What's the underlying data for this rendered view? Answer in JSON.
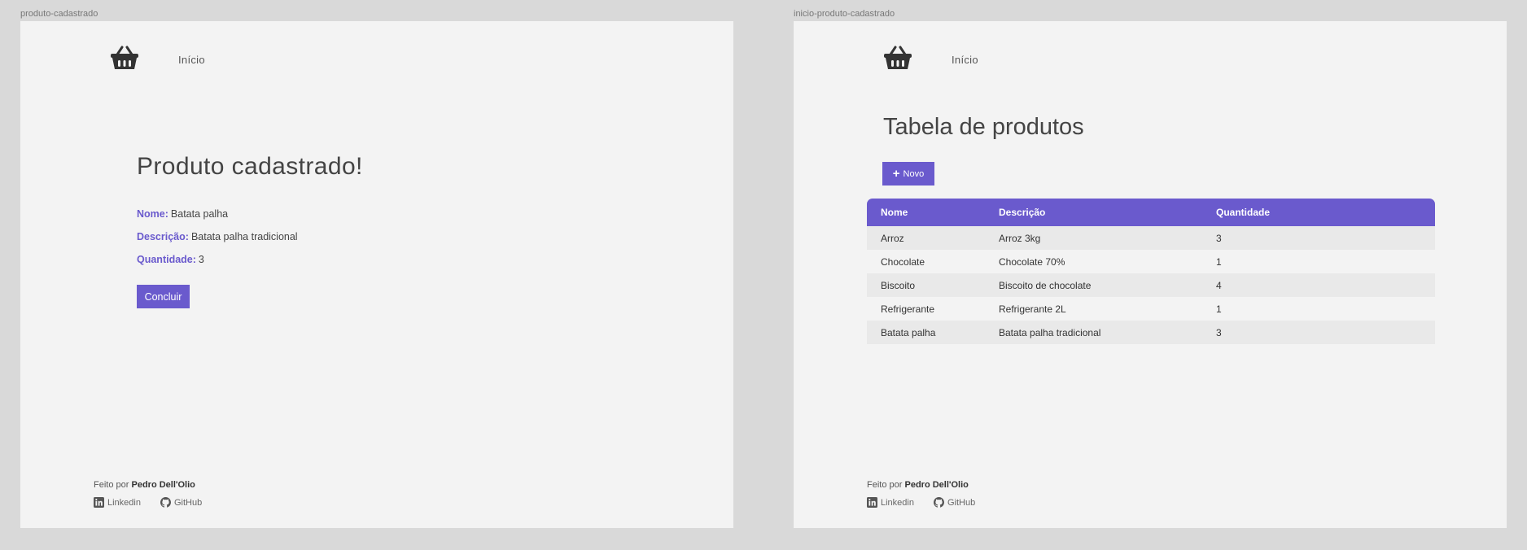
{
  "frames": [
    {
      "label": "produto-cadastrado",
      "nav": {
        "link": "Início"
      },
      "title": "Produto cadastrado!",
      "fields": [
        {
          "label": "Nome:",
          "value": "Batata palha"
        },
        {
          "label": "Descrição:",
          "value": "Batata palha tradicional"
        },
        {
          "label": "Quantidade:",
          "value": "3"
        }
      ],
      "button": "Concluir",
      "footer": {
        "prefix": "Feito por",
        "author": "Pedro Dell'Olio",
        "links": [
          "Linkedin",
          "GitHub"
        ]
      }
    },
    {
      "label": "inicio-produto-cadastrado",
      "nav": {
        "link": "Início"
      },
      "title": "Tabela de produtos",
      "button": "Novo",
      "table": {
        "headers": [
          "Nome",
          "Descrição",
          "Quantidade"
        ],
        "rows": [
          [
            "Arroz",
            "Arroz 3kg",
            "3"
          ],
          [
            "Chocolate",
            "Chocolate 70%",
            "1"
          ],
          [
            "Biscoito",
            "Biscoito de chocolate",
            "4"
          ],
          [
            "Refrigerante",
            "Refrigerante 2L",
            "1"
          ],
          [
            "Batata palha",
            "Batata palha tradicional",
            "3"
          ]
        ]
      },
      "footer": {
        "prefix": "Feito por",
        "author": "Pedro Dell'Olio",
        "links": [
          "Linkedin",
          "GitHub"
        ]
      }
    }
  ],
  "colors": {
    "accent": "#6a5acd",
    "frame_bg": "#f3f3f3",
    "canvas_bg": "#d9d9d9",
    "row_alt": "#e9e9e9"
  },
  "icons": [
    "basket-icon",
    "plus-icon",
    "linkedin-icon",
    "github-icon"
  ]
}
